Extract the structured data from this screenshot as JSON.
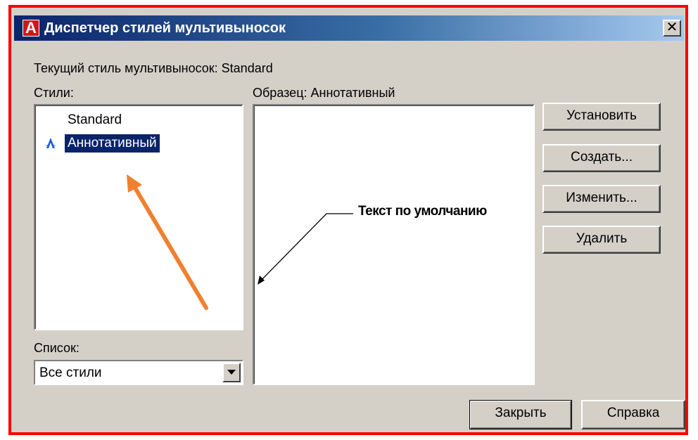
{
  "window": {
    "title": "Диспетчер стилей мультивыносок",
    "app_icon_letter": "A",
    "close_glyph": "✕"
  },
  "current_style": {
    "label": "Текущий стиль мультивыносок: Standard"
  },
  "styles": {
    "label": "Стили:",
    "items": [
      {
        "name": "Standard",
        "selected": false,
        "annotative": false
      },
      {
        "name": "Аннотативный",
        "selected": true,
        "annotative": true
      }
    ]
  },
  "preview": {
    "label": "Образец: Аннотативный",
    "sample_text": "Текст по умолчанию"
  },
  "list_filter": {
    "label": "Список:",
    "value": "Все стили"
  },
  "buttons": {
    "set": "Установить",
    "create": "Создать...",
    "modify": "Изменить...",
    "delete": "Удалить",
    "close": "Закрыть",
    "help": "Справка"
  },
  "colors": {
    "title_bar": "#0a246a",
    "selection": "#0a246a",
    "dialog_face": "#d4d0c8",
    "frame_highlight": "#ff0000",
    "arrow_annotation": "#f08030"
  },
  "icons": {
    "app": "autocad-icon",
    "annotative": "annotative-scale-icon",
    "dropdown": "chevron-down-icon",
    "close": "close-icon"
  }
}
